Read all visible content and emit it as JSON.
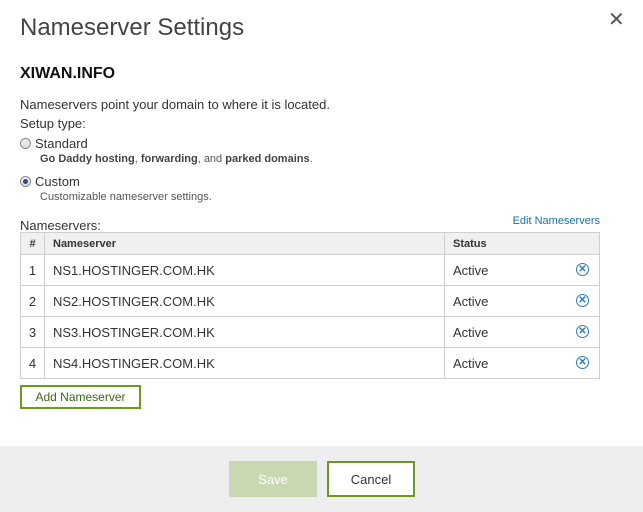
{
  "dialog": {
    "title": "Nameserver Settings",
    "close_glyph": "✕"
  },
  "domain": "XIWAN.INFO",
  "description": "Nameservers point your domain to where it is located.",
  "setup_type_label": "Setup type:",
  "options": {
    "standard": {
      "label": "Standard",
      "selected": false,
      "sub_parts": [
        "Go Daddy hosting",
        ", ",
        "forwarding",
        ", and ",
        "parked domains",
        "."
      ]
    },
    "custom": {
      "label": "Custom",
      "selected": true,
      "sub": "Customizable nameserver settings."
    }
  },
  "nameservers_label": "Nameservers:",
  "edit_link": "Edit Nameservers",
  "table": {
    "headers": [
      "#",
      "Nameserver",
      "Status"
    ],
    "rows": [
      {
        "num": "1",
        "name": "NS1.HOSTINGER.COM.HK",
        "status": "Active"
      },
      {
        "num": "2",
        "name": "NS2.HOSTINGER.COM.HK",
        "status": "Active"
      },
      {
        "num": "3",
        "name": "NS3.HOSTINGER.COM.HK",
        "status": "Active"
      },
      {
        "num": "4",
        "name": "NS4.HOSTINGER.COM.HK",
        "status": "Active"
      }
    ],
    "remove_icon": "remove-circle-icon"
  },
  "add_button": "Add Nameserver",
  "footer": {
    "save": "Save",
    "cancel": "Cancel"
  },
  "colors": {
    "accent_green": "#6c9a1f",
    "link_blue": "#1a6fa8",
    "disabled_green": "#c9d8b0"
  }
}
